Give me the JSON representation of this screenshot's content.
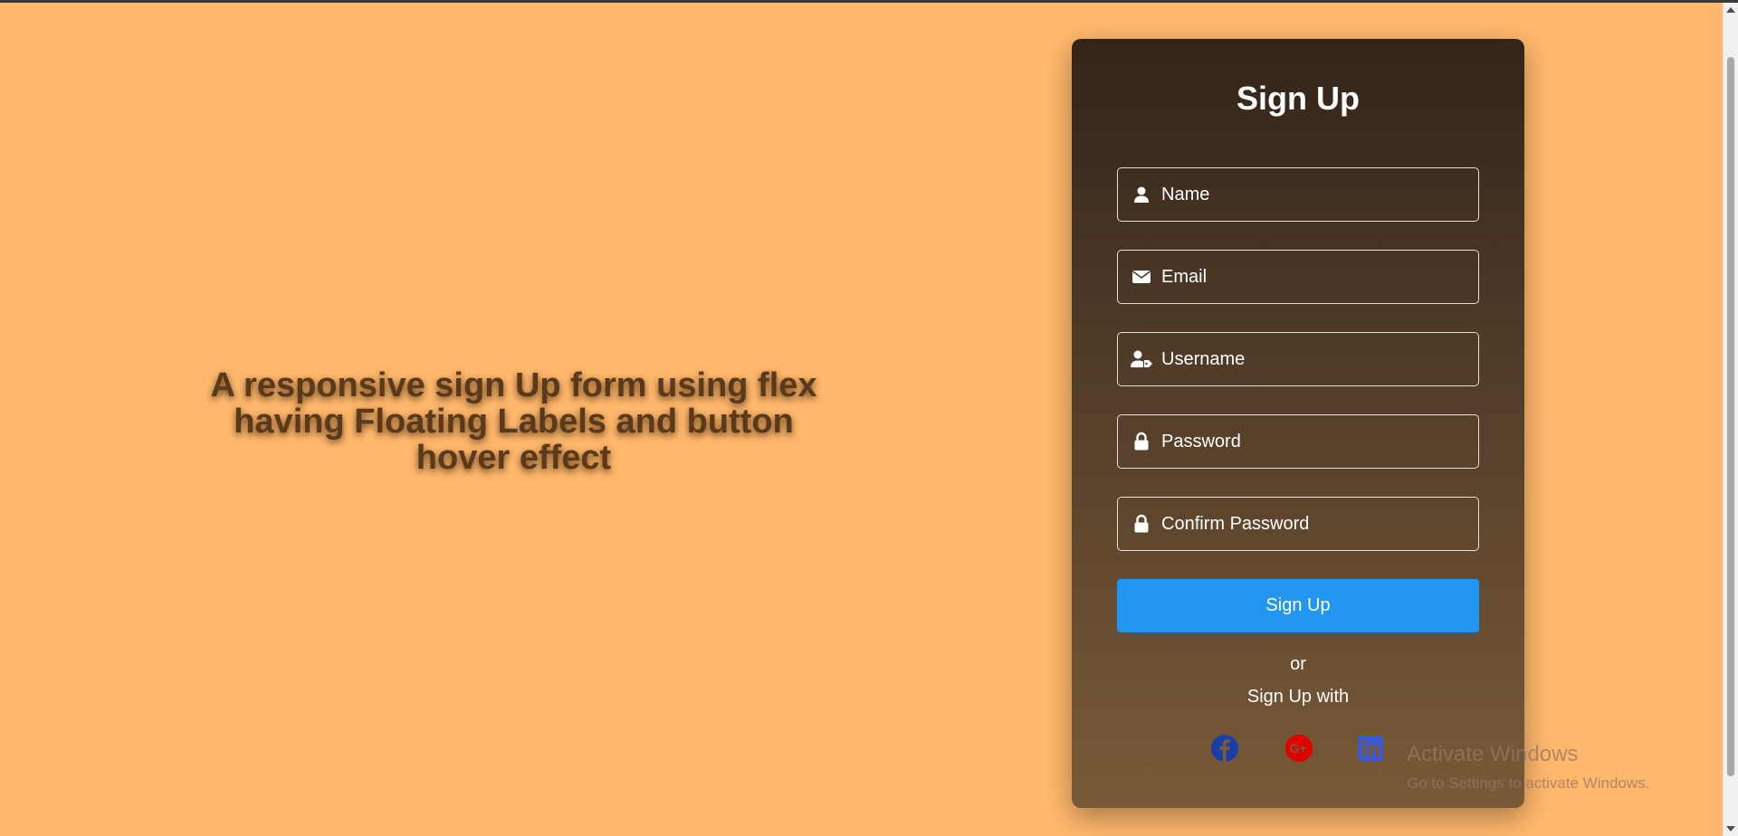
{
  "page": {
    "background_color": "#FFB86C",
    "headline": "A responsive sign Up form using flex having Floating Labels and button hover effect"
  },
  "form": {
    "title": "Sign Up",
    "fields": [
      {
        "label": "Name",
        "icon": "user-icon"
      },
      {
        "label": "Email",
        "icon": "envelope-icon"
      },
      {
        "label": "Username",
        "icon": "user-tag-icon"
      },
      {
        "label": "Password",
        "icon": "lock-icon"
      },
      {
        "label": "Confirm Password",
        "icon": "lock-icon"
      }
    ],
    "submit_label": "Sign Up",
    "submit_color": "#2196F3",
    "or_text": "or",
    "signup_with_text": "Sign Up with",
    "social": [
      {
        "name": "facebook-icon",
        "color": "#1a3fa8"
      },
      {
        "name": "google-plus-icon",
        "color": "#e00000"
      },
      {
        "name": "linkedin-icon",
        "color": "#3a5bd6"
      }
    ]
  },
  "watermark": {
    "line1": "Activate Windows",
    "line2": "Go to Settings to activate Windows."
  }
}
